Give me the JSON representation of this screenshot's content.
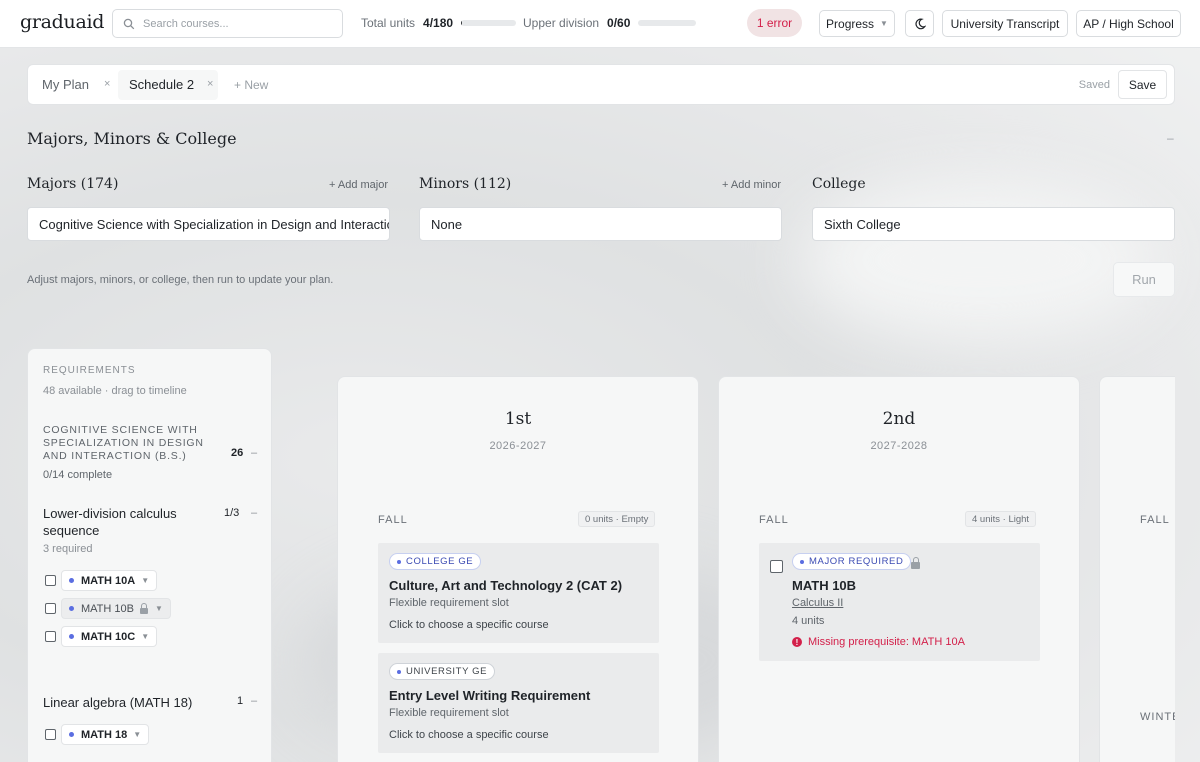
{
  "header": {
    "logo": "graduaid",
    "search_placeholder": "Search courses...",
    "total_units_label": "Total units",
    "total_units_value": "4/180",
    "total_units_progress": 0.022,
    "upper_division_label": "Upper division",
    "upper_division_value": "0/60",
    "upper_division_progress": 0,
    "error_badge": "1 error",
    "progress_label": "Progress",
    "theme_icon": "moon-icon",
    "transcript_label": "University Transcript",
    "ap_label": "AP / High School"
  },
  "tabs": {
    "items": [
      {
        "label": "My Plan",
        "active": false
      },
      {
        "label": "Schedule 2",
        "active": true
      }
    ],
    "close_glyph": "×",
    "new_label": "+ New",
    "saved_label": "Saved",
    "save_label": "Save"
  },
  "majors_section": {
    "title": "Majors, Minors & College",
    "collapse_glyph": "–",
    "majors_title": "Majors (174)",
    "add_major": "+ Add major",
    "major_value": "Cognitive Science with Specialization in Design and Interaction (B.S.)",
    "minors_title": "Minors (112)",
    "add_minor": "+ Add minor",
    "minor_value": "None",
    "college_title": "College",
    "college_value": "Sixth College",
    "hint": "Adjust majors, minors, or college, then run to update your plan.",
    "run_label": "Run"
  },
  "requirements": {
    "heading": "REQUIREMENTS",
    "subheading": "48 available · drag to timeline",
    "major_name": "COGNITIVE SCIENCE WITH SPECIALIZATION IN DESIGN AND INTERACTION (B.S.)",
    "major_count": "26",
    "major_complete": "0/14 complete",
    "dash": "–",
    "groups": [
      {
        "title": "Lower-division calculus sequence",
        "count": "1/3",
        "sub": "3 required",
        "courses": [
          {
            "code": "MATH 10A",
            "locked": false
          },
          {
            "code": "MATH 10B",
            "locked": true
          },
          {
            "code": "MATH 10C",
            "locked": false
          }
        ]
      },
      {
        "title": "Linear algebra (MATH 18)",
        "count": "1",
        "courses": [
          {
            "code": "MATH 18",
            "locked": false
          }
        ]
      }
    ]
  },
  "years": [
    {
      "label": "1st",
      "range": "2026-2027",
      "term": "FALL",
      "term_units": "0 units",
      "term_load": "Empty",
      "courses": [
        {
          "badge": "COLLEGE GE",
          "title": "Culture, Art and Technology 2 (CAT 2)",
          "sub": "Flexible requirement slot",
          "action": "Click to choose a specific course"
        },
        {
          "badge": "UNIVERSITY GE",
          "title": "Entry Level Writing Requirement",
          "sub": "Flexible requirement slot",
          "action": "Click to choose a specific course"
        }
      ]
    },
    {
      "label": "2nd",
      "range": "2027-2028",
      "term": "FALL",
      "term_units": "4 units",
      "term_load": "Light",
      "courses": [
        {
          "badge": "MAJOR REQUIRED",
          "title": "MATH 10B",
          "sub": "Calculus II",
          "units": "4 units",
          "error": "Missing prerequisite: MATH 10A"
        }
      ]
    },
    {
      "term": "FALL",
      "term2": "WINTER"
    }
  ],
  "colors": {
    "accent": "#5b6ee1",
    "error": "#d3204a"
  }
}
